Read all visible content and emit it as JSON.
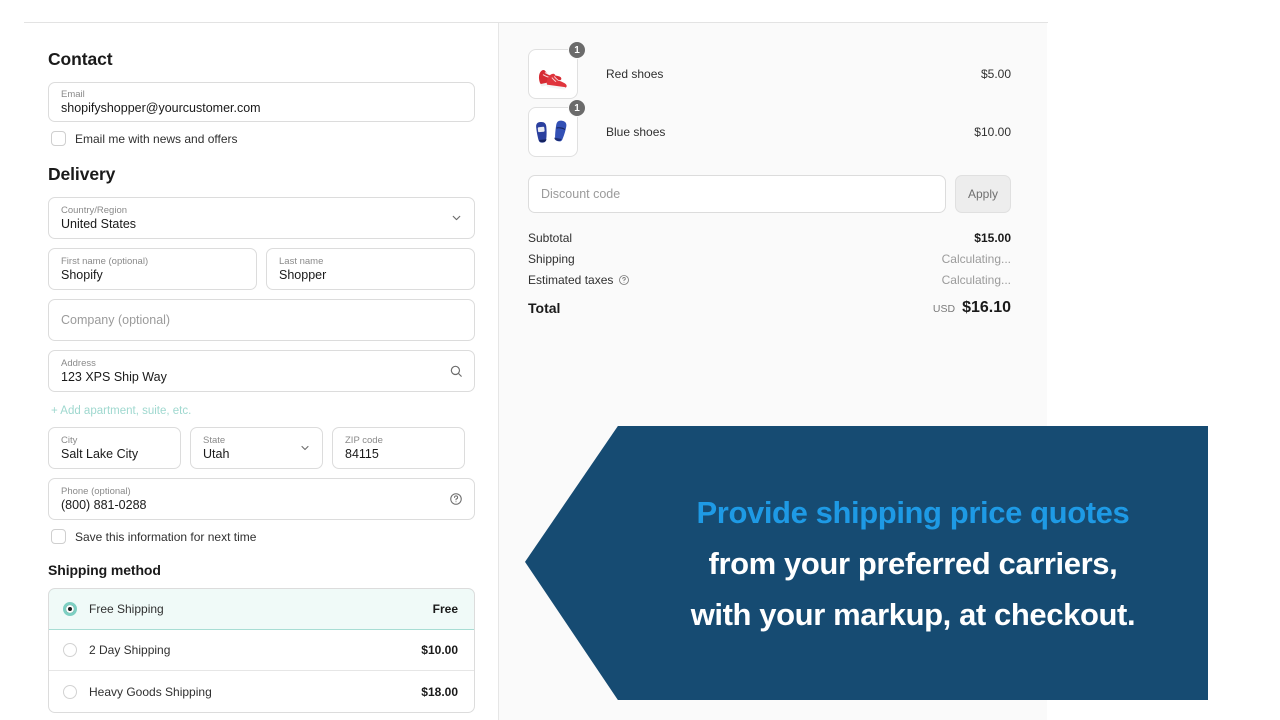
{
  "contact": {
    "heading": "Contact",
    "email": {
      "label": "Email",
      "value": "shopifyshopper@yourcustomer.com"
    },
    "newsletter_checkbox_label": "Email me with news and offers"
  },
  "delivery": {
    "heading": "Delivery",
    "country": {
      "label": "Country/Region",
      "value": "United States",
      "icon": "chevron-down-icon"
    },
    "first_name": {
      "label": "First name (optional)",
      "value": "Shopify"
    },
    "last_name": {
      "label": "Last name",
      "value": "Shopper"
    },
    "company": {
      "placeholder": "Company (optional)",
      "value": ""
    },
    "address": {
      "label": "Address",
      "value": "123 XPS Ship Way",
      "icon": "search-icon"
    },
    "add_apartment_link": "+ Add apartment, suite, etc.",
    "city": {
      "label": "City",
      "value": "Salt Lake City"
    },
    "state": {
      "label": "State",
      "value": "Utah",
      "icon": "chevron-down-icon"
    },
    "zip": {
      "label": "ZIP code",
      "value": "84115"
    },
    "phone": {
      "label": "Phone (optional)",
      "value": "(800) 881-0288",
      "icon": "help-circle-icon"
    },
    "save_info_checkbox_label": "Save this information for next time"
  },
  "shipping_method": {
    "heading": "Shipping method",
    "options": [
      {
        "name": "Free Shipping",
        "price": "Free",
        "selected": true
      },
      {
        "name": "2 Day Shipping",
        "price": "$10.00",
        "selected": false
      },
      {
        "name": "Heavy Goods Shipping",
        "price": "$18.00",
        "selected": false
      }
    ]
  },
  "order_summary": {
    "items": [
      {
        "name": "Red shoes",
        "price": "$5.00",
        "qty": "1",
        "thumb": "red-sneakers-thumbnail"
      },
      {
        "name": "Blue shoes",
        "price": "$10.00",
        "qty": "1",
        "thumb": "blue-loafers-thumbnail"
      }
    ],
    "discount": {
      "placeholder": "Discount code",
      "value": "",
      "apply_label": "Apply"
    },
    "lines": [
      {
        "label": "Subtotal",
        "value": "$15.00",
        "bold": true,
        "muted": false,
        "info": false
      },
      {
        "label": "Shipping",
        "value": "Calculating...",
        "bold": false,
        "muted": true,
        "info": false
      },
      {
        "label": "Estimated taxes",
        "value": "Calculating...",
        "bold": false,
        "muted": true,
        "info": true
      }
    ],
    "total": {
      "label": "Total",
      "currency": "USD",
      "amount": "$16.10"
    }
  },
  "banner": {
    "line1": "Provide shipping price quotes",
    "line2": "from your preferred carriers,",
    "line3": "with your markup, at checkout.",
    "bg_color": "#164b72",
    "accent_color": "#1e9ae5"
  }
}
